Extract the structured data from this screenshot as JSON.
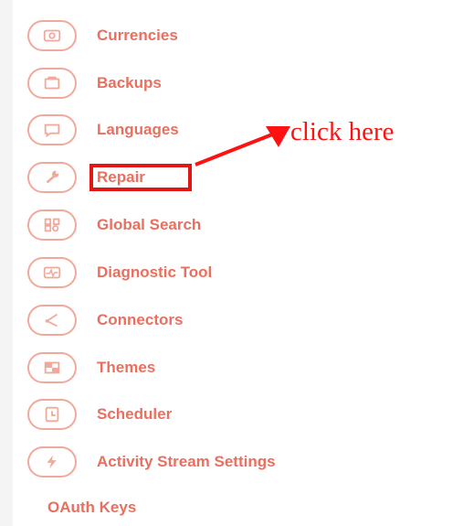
{
  "colors": {
    "menu_text": "#ea6f5f",
    "icon_outline": "#f1a99b",
    "annotation": "#ff1111",
    "highlight_box": "#e31616"
  },
  "menu": {
    "items": [
      {
        "label": "Currencies",
        "icon": "currency-icon"
      },
      {
        "label": "Backups",
        "icon": "backup-icon"
      },
      {
        "label": "Languages",
        "icon": "language-icon"
      },
      {
        "label": "Repair",
        "icon": "wrench-icon"
      },
      {
        "label": "Global Search",
        "icon": "search-grid-icon"
      },
      {
        "label": "Diagnostic Tool",
        "icon": "diagnostic-icon"
      },
      {
        "label": "Connectors",
        "icon": "connector-icon"
      },
      {
        "label": "Themes",
        "icon": "theme-icon"
      },
      {
        "label": "Scheduler",
        "icon": "clock-icon"
      },
      {
        "label": "Activity Stream Settings",
        "icon": "lightning-icon"
      }
    ],
    "last_item": "OAuth Keys"
  },
  "annotation": {
    "text": "click here",
    "target": "Repair"
  }
}
